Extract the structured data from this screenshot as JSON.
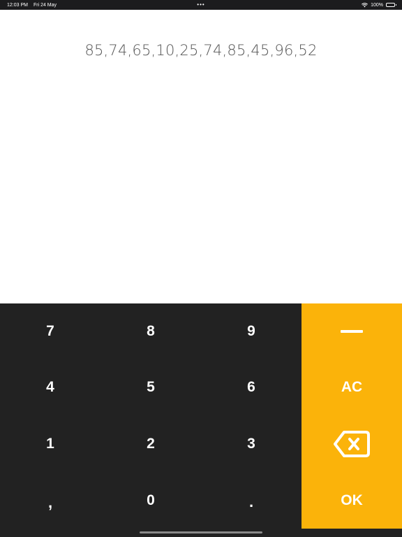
{
  "status_bar": {
    "time": "12:03 PM",
    "date": "Fri 24 May",
    "center_dots": "•••",
    "battery_text": "100%",
    "battery_level": 1.0
  },
  "display": {
    "value": "85,74,65,10,25,74,85,45,96,52"
  },
  "keypad": {
    "keys": [
      "7",
      "8",
      "9",
      "4",
      "5",
      "6",
      "1",
      "2",
      "3",
      ",",
      "0",
      "."
    ],
    "clear_label": "AC",
    "ok_label": "OK",
    "minus_icon": "minus-icon",
    "backspace_icon": "backspace-icon"
  },
  "colors": {
    "keypad_bg": "#222222",
    "action_bg": "#fbb30a",
    "display_bg": "#ffffff",
    "display_text": "#555555"
  }
}
